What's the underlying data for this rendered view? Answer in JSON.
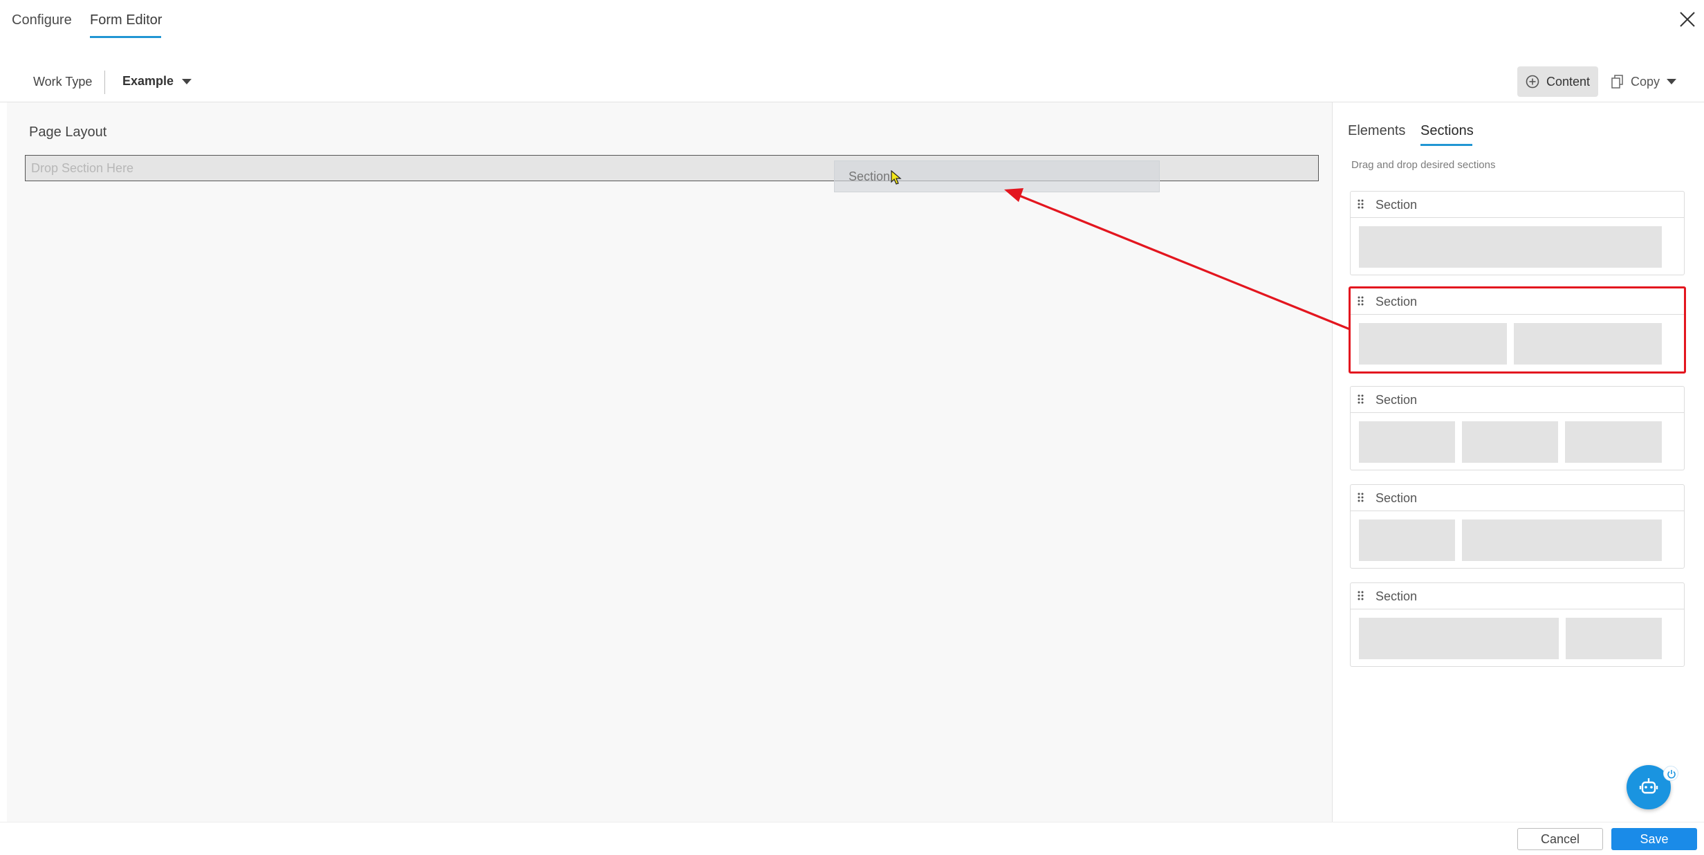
{
  "top_tabs": {
    "configure": "Configure",
    "form_editor": "Form Editor"
  },
  "toolbar": {
    "work_type_label": "Work Type",
    "work_type_value": "Example",
    "content_label": "Content",
    "copy_label": "Copy"
  },
  "canvas": {
    "title": "Page Layout",
    "drop_placeholder": "Drop Section Here",
    "drag_ghost_label": "Section"
  },
  "panel": {
    "tabs": {
      "elements": "Elements",
      "sections": "Sections"
    },
    "hint": "Drag and drop desired sections",
    "sections": [
      {
        "title": "Section"
      },
      {
        "title": "Section"
      },
      {
        "title": "Section"
      },
      {
        "title": "Section"
      },
      {
        "title": "Section"
      }
    ]
  },
  "footer": {
    "cancel_label": "Cancel",
    "save_label": "Save"
  },
  "colors": {
    "accent": "#2196d3",
    "save_button": "#1a8be8",
    "annotation": "#e3161f"
  },
  "icons": {
    "close": "close-icon",
    "content": "plus-circle-icon",
    "copy": "copy-icon",
    "grip": "drag-handle-icon",
    "assistant": "bot-icon"
  }
}
